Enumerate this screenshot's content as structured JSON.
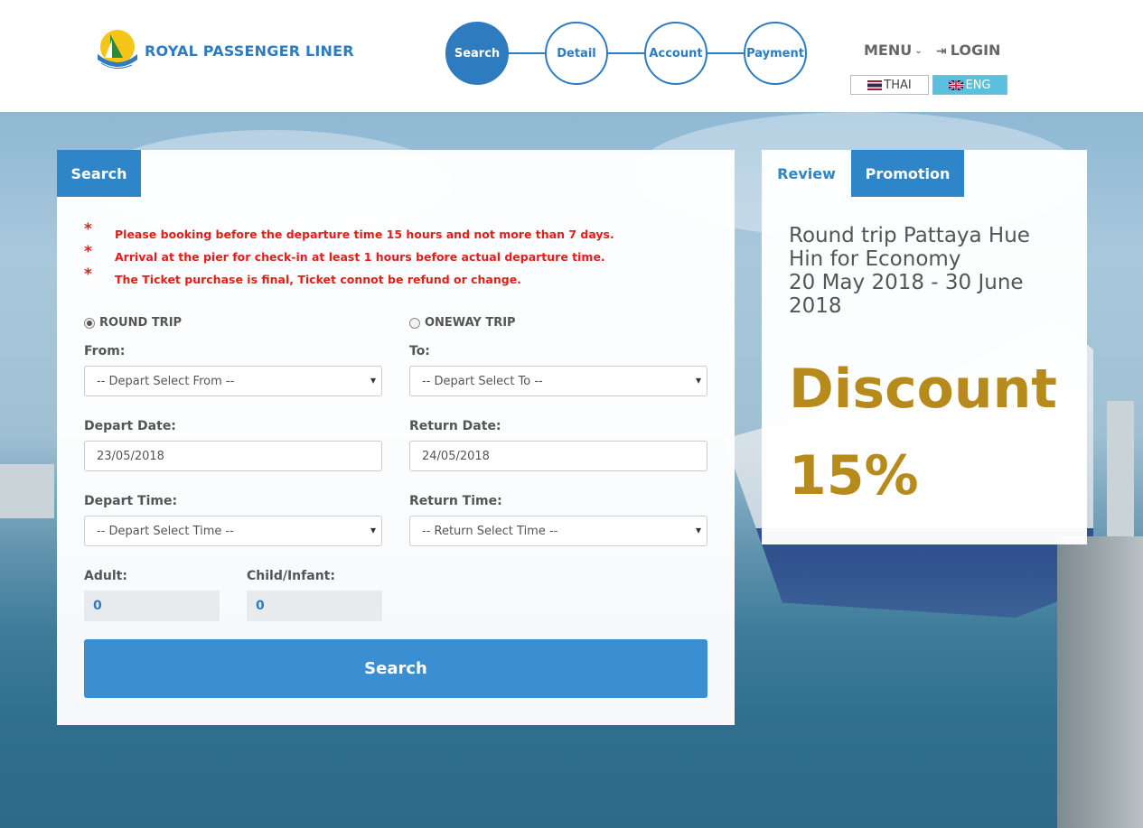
{
  "header": {
    "brand": "ROYAL PASSENGER LINER",
    "steps": [
      "Search",
      "Detail",
      "Account",
      "Payment"
    ],
    "menu_label": "MENU",
    "login_label": "LOGIN",
    "lang_thai": "THAI",
    "lang_eng": "ENG"
  },
  "search_card": {
    "tab": "Search",
    "notes": [
      "Please booking before the departure time 15 hours and not more than 7 days.",
      "Arrival at the pier for check-in at least 1 hours before actual departure time.",
      "The Ticket purchase is final, Ticket connot be refund or change."
    ],
    "star": "*",
    "round_trip": "ROUND TRIP",
    "oneway_trip": "ONEWAY TRIP",
    "from_label": "From:",
    "to_label": "To:",
    "from_value": "-- Depart Select From --",
    "to_value": "-- Depart Select To --",
    "depart_date_label": "Depart Date:",
    "return_date_label": "Return Date:",
    "depart_date": "23/05/2018",
    "return_date": "24/05/2018",
    "depart_time_label": "Depart Time:",
    "return_time_label": "Return Time:",
    "depart_time": "-- Depart Select Time --",
    "return_time": "-- Return Select Time --",
    "adult_label": "Adult:",
    "child_label": "Child/Infant:",
    "adult_value": "0",
    "child_value": "0",
    "search_button": "Search"
  },
  "promo_card": {
    "tab_review": "Review",
    "tab_promotion": "Promotion",
    "title_lines": [
      "Round trip Pattaya Hue",
      "Hin for Economy",
      "20 May 2018 - 30 June",
      "2018"
    ],
    "discount": "Discount",
    "percent": "15%"
  },
  "colors": {
    "primary": "#2e86c8",
    "warning": "#e0201a",
    "gold": "#b78a1c"
  }
}
